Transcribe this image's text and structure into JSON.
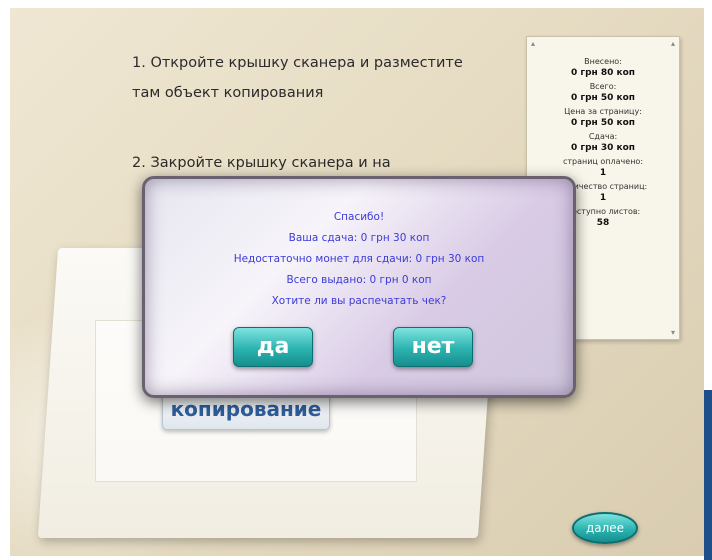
{
  "instructions": {
    "step1": "1.  Откройте крышку сканера и разместите  там объект копирования",
    "step2": "2.  Закройте крышку сканера и на"
  },
  "panel": {
    "items": [
      {
        "label": "Внесено:",
        "value": "0 грн 80 коп"
      },
      {
        "label": "Всего:",
        "value": "0 грн 50 коп"
      },
      {
        "label": "Цена за страницу:",
        "value": "0 грн 50 коп"
      },
      {
        "label": "Сдача:",
        "value": "0 грн 30 коп"
      },
      {
        "label": "страниц оплачено:",
        "value": "1"
      },
      {
        "label": "количество страниц:",
        "value": "1"
      },
      {
        "label": "Доступно листов:",
        "value": "58"
      }
    ]
  },
  "dialog": {
    "lines": [
      "Спасибо!",
      "Ваша сдача: 0 грн 30 коп",
      "Недостаточно монет для сдачи: 0 грн 30 коп",
      "Всего выдано: 0 грн 0 коп",
      "Хотите ли вы распечатать чек?"
    ],
    "yes_label": "да",
    "no_label": "нет"
  },
  "copy_button_label": "копирование",
  "next_button_label": "далее",
  "colors": {
    "dialog_text": "#3b3bd8",
    "button_teal": "#2bb3b0",
    "copy_text": "#2e5e9a"
  }
}
